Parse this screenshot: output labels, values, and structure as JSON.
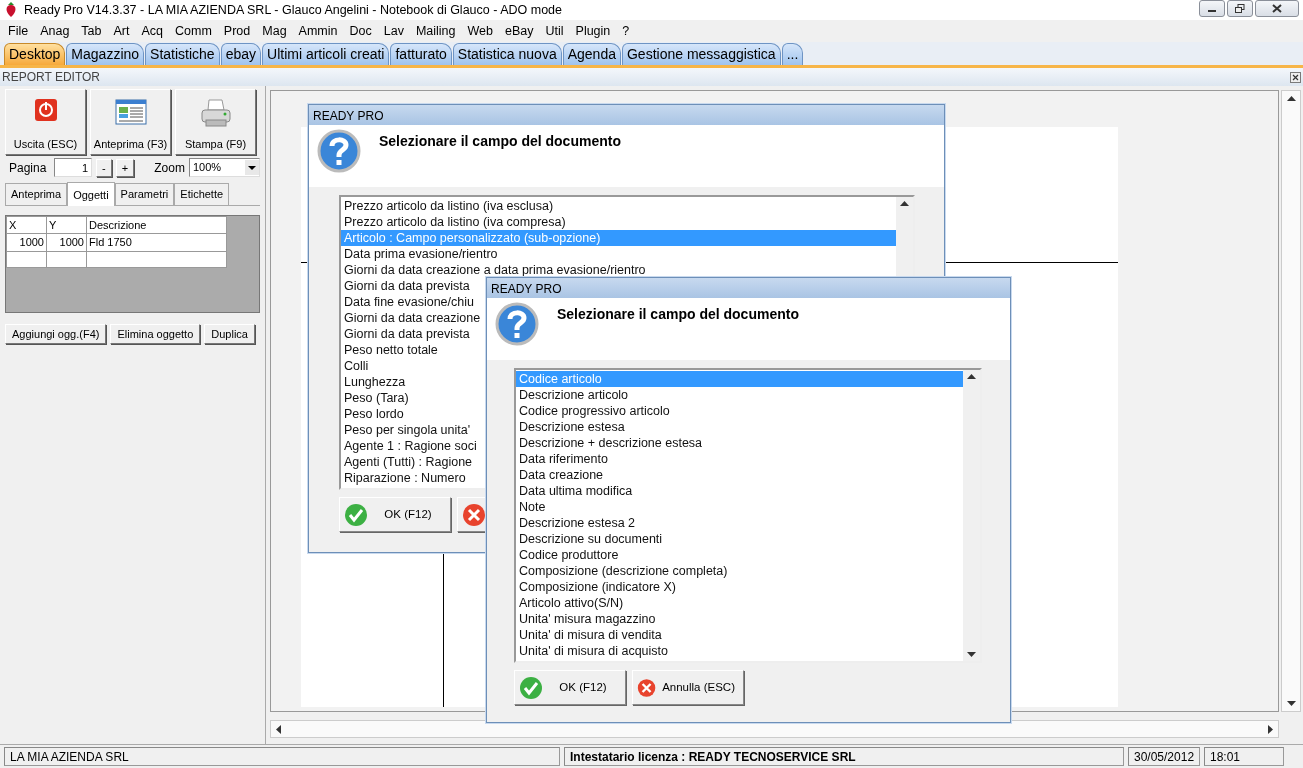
{
  "window": {
    "title": "Ready Pro V14.3.37 - LA MIA AZIENDA SRL - Glauco Angelini - Notebook di Glauco - ADO mode"
  },
  "menu": [
    "File",
    "Anag",
    "Tab",
    "Art",
    "Acq",
    "Comm",
    "Prod",
    "Mag",
    "Ammin",
    "Doc",
    "Lav",
    "Mailing",
    "Web",
    "eBay",
    "Util",
    "Plugin",
    "?"
  ],
  "tabs": [
    {
      "label": "Desktop",
      "selected": true
    },
    {
      "label": "Magazzino",
      "selected": false
    },
    {
      "label": "Statistiche",
      "selected": false
    },
    {
      "label": "ebay",
      "selected": false
    },
    {
      "label": "Ultimi articoli creati",
      "selected": false
    },
    {
      "label": "fatturato",
      "selected": false
    },
    {
      "label": "Statistica nuova",
      "selected": false
    },
    {
      "label": "Agenda",
      "selected": false
    },
    {
      "label": "Gestione messaggistica",
      "selected": false
    },
    {
      "label": "...",
      "selected": false
    }
  ],
  "panel": {
    "title": "REPORT EDITOR"
  },
  "toolbar": [
    {
      "kind": "exit",
      "label": "Uscita (ESC)"
    },
    {
      "kind": "preview",
      "label": "Anteprima (F3)"
    },
    {
      "kind": "print",
      "label": "Stampa (F9)"
    }
  ],
  "page": {
    "label": "Pagina",
    "value": "1",
    "buttons": [
      "-",
      "+"
    ]
  },
  "zoom": {
    "label": "Zoom",
    "value": "100%"
  },
  "subtabs": [
    {
      "label": "Anteprima",
      "selected": false
    },
    {
      "label": "Oggetti",
      "selected": true
    },
    {
      "label": "Parametri",
      "selected": false
    },
    {
      "label": "Etichette",
      "selected": false
    }
  ],
  "objects_table": {
    "columns": [
      "X",
      "Y",
      "Descrizione"
    ],
    "rows": [
      [
        "1000",
        "1000",
        "Fld 1750"
      ]
    ]
  },
  "object_buttons": [
    "Aggiungi ogg.(F4)",
    "Elimina oggetto",
    "Duplica"
  ],
  "dialogs": [
    {
      "title": "READY PRO",
      "heading": "Selezionare il campo del documento",
      "items": [
        {
          "label": "Prezzo articolo da listino (iva esclusa)",
          "selected": false
        },
        {
          "label": "Prezzo articolo da listino (iva compresa)",
          "selected": false
        },
        {
          "label": "Articolo : Campo personalizzato (sub-opzione)",
          "selected": true
        },
        {
          "label": "Data prima evasione/rientro",
          "selected": false
        },
        {
          "label": "Giorni da data creazione a data prima evasione/rientro",
          "selected": false
        },
        {
          "label": "Giorni da data prevista",
          "selected": false
        },
        {
          "label": "Data fine evasione/chiu",
          "selected": false
        },
        {
          "label": "Giorni da data creazione",
          "selected": false
        },
        {
          "label": "Giorni da data prevista",
          "selected": false
        },
        {
          "label": "Peso netto totale",
          "selected": false
        },
        {
          "label": "Colli",
          "selected": false
        },
        {
          "label": "Lunghezza",
          "selected": false
        },
        {
          "label": "Peso (Tara)",
          "selected": false
        },
        {
          "label": "Peso lordo",
          "selected": false
        },
        {
          "label": "Peso per singola unita'",
          "selected": false
        },
        {
          "label": "Agente 1 : Ragione soci",
          "selected": false
        },
        {
          "label": "Agenti (Tutti) : Ragione",
          "selected": false
        },
        {
          "label": "Riparazione : Numero",
          "selected": false
        }
      ],
      "buttons": [
        {
          "kind": "ok",
          "label": "OK (F12)"
        },
        {
          "kind": "cancel"
        }
      ]
    },
    {
      "title": "READY PRO",
      "heading": "Selezionare il campo del documento",
      "items": [
        {
          "label": "Codice articolo",
          "selected": true
        },
        {
          "label": "Descrizione articolo",
          "selected": false
        },
        {
          "label": "Codice progressivo articolo",
          "selected": false
        },
        {
          "label": "Descrizione estesa",
          "selected": false
        },
        {
          "label": "Descrizione + descrizione estesa",
          "selected": false
        },
        {
          "label": "Data riferimento",
          "selected": false
        },
        {
          "label": "Data creazione",
          "selected": false
        },
        {
          "label": "Data ultima modifica",
          "selected": false
        },
        {
          "label": "Note",
          "selected": false
        },
        {
          "label": "Descrizione estesa 2",
          "selected": false
        },
        {
          "label": "Descrizione su documenti",
          "selected": false
        },
        {
          "label": "Codice produttore",
          "selected": false
        },
        {
          "label": "Composizione (descrizione completa)",
          "selected": false
        },
        {
          "label": "Composizione (indicatore X)",
          "selected": false
        },
        {
          "label": "Articolo attivo(S/N)",
          "selected": false
        },
        {
          "label": "Unita' misura magazzino",
          "selected": false
        },
        {
          "label": "Unita' di misura di vendita",
          "selected": false
        },
        {
          "label": "Unita' di misura di acquisto",
          "selected": false
        }
      ],
      "buttons": [
        {
          "kind": "ok",
          "label": "OK (F12)"
        },
        {
          "kind": "cancel",
          "label": "Annulla (ESC)"
        }
      ]
    }
  ],
  "status_bar": [
    "LA MIA AZIENDA SRL",
    "Intestatario licenza : READY TECNOSERVICE SRL",
    "30/05/2012",
    "18:01"
  ]
}
